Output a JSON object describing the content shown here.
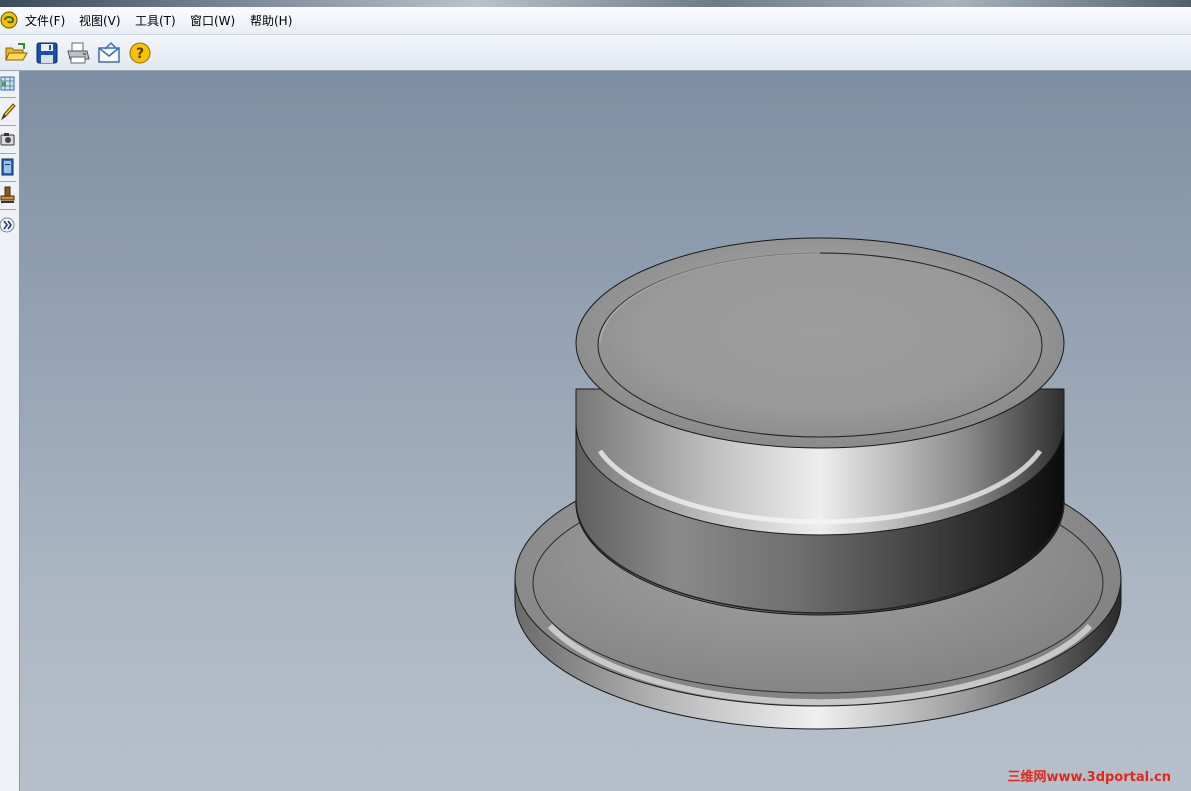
{
  "menu": {
    "items": [
      {
        "label": "文件(F)"
      },
      {
        "label": "视图(V)"
      },
      {
        "label": "工具(T)"
      },
      {
        "label": "窗口(W)"
      },
      {
        "label": "帮助(H)"
      }
    ]
  },
  "toolbar": {
    "icons": [
      "open-folder-icon",
      "save-disk-icon",
      "print-icon",
      "email-envelope-icon",
      "help-question-icon"
    ]
  },
  "left_toolbar": {
    "icons": [
      "grid-view-icon",
      "pencil-icon",
      "camera-icon",
      "book-icon",
      "stamp-icon",
      "expand-chevron-icon"
    ],
    "expand_label": "»"
  },
  "viewport": {
    "model": "3d-knob-cap-model",
    "background_top": "#7e8fa3",
    "background_bottom": "#b7c0ca"
  },
  "watermark": {
    "text": "三维网www.3dportal.cn",
    "color": "#e3271d"
  }
}
